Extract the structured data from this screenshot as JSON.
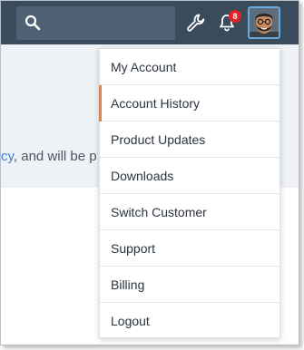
{
  "header": {
    "search_icon": "search-icon",
    "tools_icon": "wrench-icon",
    "notifications_icon": "bell-icon",
    "notification_count": "8",
    "avatar": "user-avatar"
  },
  "background": {
    "text_link": "cy",
    "text_rest": ", and will be p"
  },
  "menu": {
    "active_index": 1,
    "accent_color": "#e8823a",
    "items": [
      {
        "label": "My Account"
      },
      {
        "label": "Account History"
      },
      {
        "label": "Product Updates"
      },
      {
        "label": "Downloads"
      },
      {
        "label": "Switch Customer"
      },
      {
        "label": "Support"
      },
      {
        "label": "Billing"
      },
      {
        "label": "Logout"
      }
    ]
  }
}
